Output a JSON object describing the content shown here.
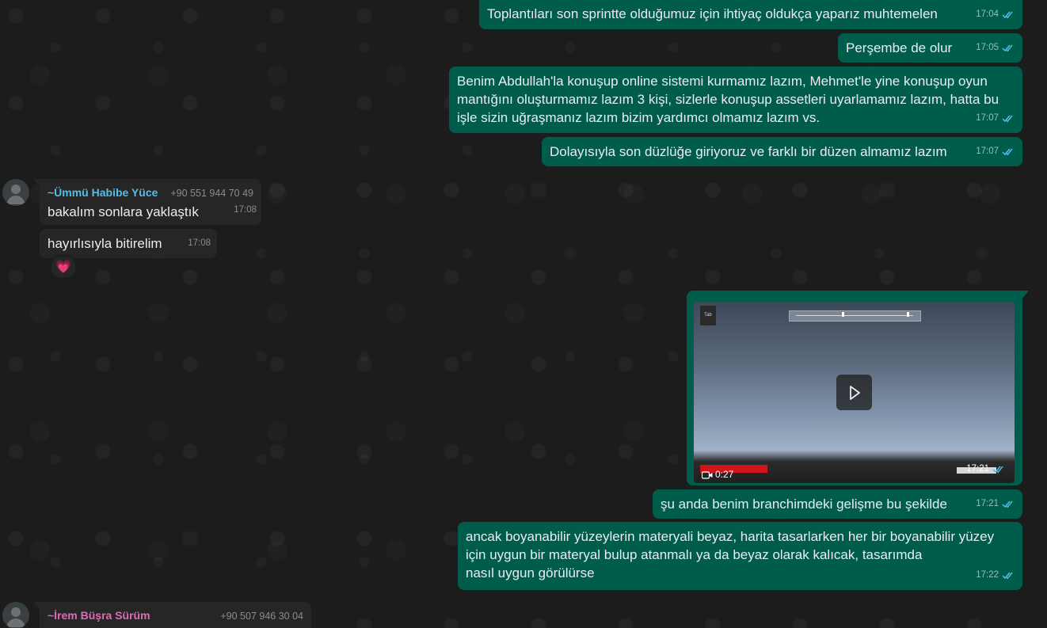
{
  "messages": {
    "m1": {
      "text": "Toplantıları son sprintte olduğumuz için ihtiyaç oldukça yaparız muhtemelen",
      "time": "17:04"
    },
    "m2": {
      "text": "Perşembe de olur",
      "time": "17:05"
    },
    "m3": {
      "text": "Benim Abdullah'la konuşup online sistemi kurmamız lazım, Mehmet'le yine konuşup oyun\nmantığını oluşturmamız lazım 3 kişi, sizlerle konuşup assetleri uyarlamamız lazım, hatta bu\nişle sizin uğraşmanız lazım bizim yardımcı olmamız lazım vs.",
      "time": "17:07"
    },
    "m4": {
      "text": "Dolayısıyla son düzlüğe giriyoruz ve farklı bir düzen almamız lazım",
      "time": "17:07"
    },
    "m5": {
      "sender": "~Ümmü Habibe Yüce",
      "phone": "+90 551 944 70 49",
      "text": "bakalım sonlara yaklaştık",
      "time": "17:08"
    },
    "m6": {
      "text": "hayırlısıyla bitirelim",
      "time": "17:08",
      "reaction": "💗"
    },
    "video": {
      "duration": "0:27",
      "time": "17:21",
      "tab_label": "Tab"
    },
    "m8": {
      "text": "şu anda benim branchimdeki gelişme bu şekilde",
      "time": "17:21"
    },
    "m9": {
      "text": "ancak boyanabilir yüzeylerin materyali beyaz, harita tasarlarken her bir boyanabilir yüzey\niçin uygun bir materyal bulup atanmalı ya da beyaz olarak kalıcak, tasarımda\nnasıl uygun görülürse",
      "time": "17:22"
    },
    "m10": {
      "sender": "~İrem Büşra Sürüm",
      "phone": "+90 507 946 30 04"
    }
  },
  "colors": {
    "outgoing_bubble": "#005c4b",
    "incoming_bubble": "#262626",
    "sender1_name": "#53bdeb",
    "sender2_name": "#e26ab6",
    "read_check": "#53bdeb"
  },
  "icons": {
    "read_receipt": "double-check-icon",
    "video_play": "play-icon",
    "video_camera": "video-camera-icon",
    "avatar": "default-avatar-icon"
  }
}
